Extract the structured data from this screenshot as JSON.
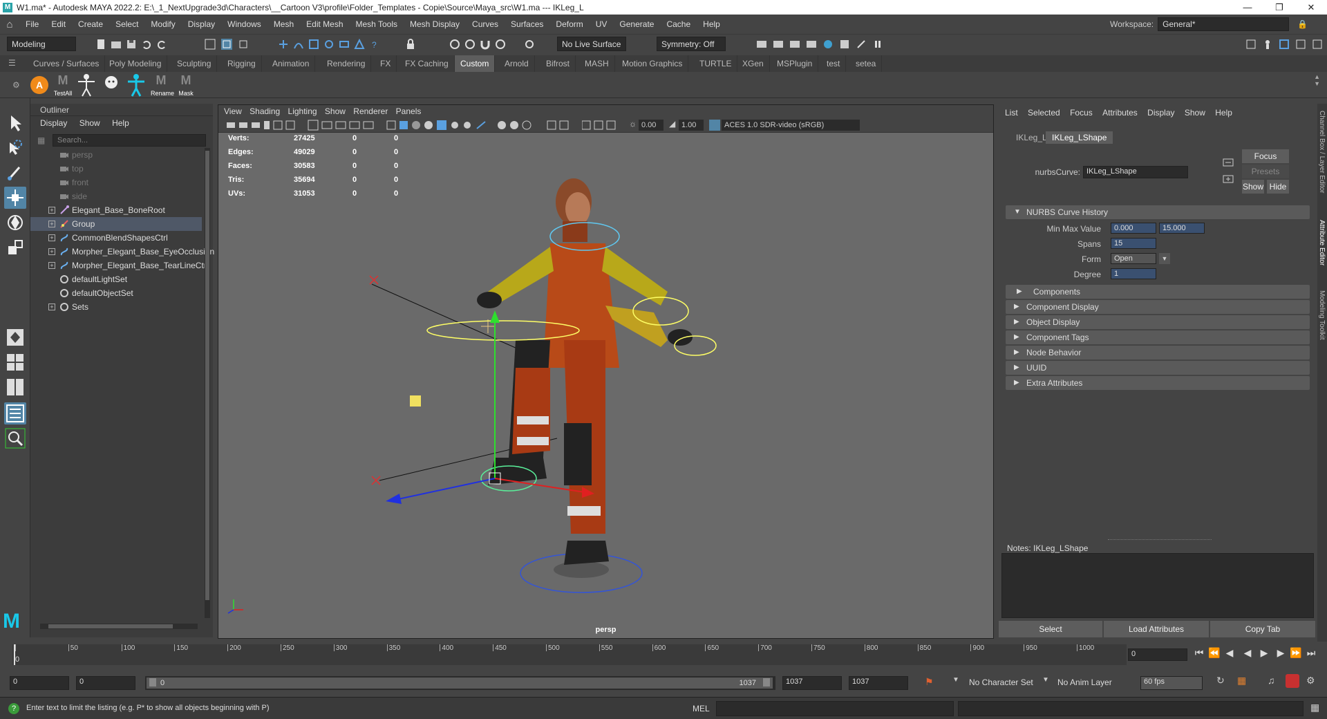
{
  "window": {
    "title": "W1.ma* - Autodesk MAYA 2022.2: E:\\_1_NextUpgrade3d\\Characters\\__Cartoon V3\\profile\\Folder_Templates - Copie\\Source\\Maya_src\\W1.ma  ---  IKLeg_L",
    "logo": "M"
  },
  "menubar": [
    "File",
    "Edit",
    "Create",
    "Select",
    "Modify",
    "Display",
    "Windows",
    "Mesh",
    "Edit Mesh",
    "Mesh Tools",
    "Mesh Display",
    "Curves",
    "Surfaces",
    "Deform",
    "UV",
    "Generate",
    "Cache",
    "Help"
  ],
  "workspace": {
    "label": "Workspace:",
    "value": "General*"
  },
  "statusline": {
    "mode": "Modeling",
    "live_surface": "No Live Surface",
    "symmetry": "Symmetry: Off"
  },
  "shelf_tabs": [
    "Curves / Surfaces",
    "Poly Modeling",
    "Sculpting",
    "Rigging",
    "Animation",
    "Rendering",
    "FX",
    "FX Caching",
    "Custom",
    "Arnold",
    "Bifrost",
    "MASH",
    "Motion Graphics",
    "TURTLE",
    "XGen",
    "MSPlugin",
    "test",
    "setea"
  ],
  "shelf_active": "Custom",
  "shelf_buttons": {
    "testall": "TestAll",
    "rename": "Rename",
    "mask": "Mask",
    "a": "A",
    "m": "M"
  },
  "outliner": {
    "title": "Outliner",
    "menu": [
      "Display",
      "Show",
      "Help"
    ],
    "search_placeholder": "Search...",
    "items": [
      {
        "label": "persp",
        "kind": "camera"
      },
      {
        "label": "top",
        "kind": "camera"
      },
      {
        "label": "front",
        "kind": "camera"
      },
      {
        "label": "side",
        "kind": "camera"
      },
      {
        "label": "Elegant_Base_BoneRoot",
        "kind": "joint"
      },
      {
        "label": "Group",
        "kind": "group",
        "selected": true
      },
      {
        "label": "CommonBlendShapesCtrl",
        "kind": "curve"
      },
      {
        "label": "Morpher_Elegant_Base_EyeOcclusion",
        "kind": "curve"
      },
      {
        "label": "Morpher_Elegant_Base_TearLineCtrl",
        "kind": "curve"
      },
      {
        "label": "defaultLightSet",
        "kind": "set"
      },
      {
        "label": "defaultObjectSet",
        "kind": "set"
      },
      {
        "label": "Sets",
        "kind": "set"
      }
    ]
  },
  "viewport": {
    "menu": [
      "View",
      "Shading",
      "Lighting",
      "Show",
      "Renderer",
      "Panels"
    ],
    "field_a": "0.00",
    "field_b": "1.00",
    "color_space": "ACES 1.0 SDR-video (sRGB)",
    "camera": "persp",
    "hud": [
      {
        "label": "Verts:",
        "v1": "27425",
        "v2": "0",
        "v3": "0"
      },
      {
        "label": "Edges:",
        "v1": "49029",
        "v2": "0",
        "v3": "0"
      },
      {
        "label": "Faces:",
        "v1": "30583",
        "v2": "0",
        "v3": "0"
      },
      {
        "label": "Tris:",
        "v1": "35694",
        "v2": "0",
        "v3": "0"
      },
      {
        "label": "UVs:",
        "v1": "31053",
        "v2": "0",
        "v3": "0"
      }
    ]
  },
  "attribute_editor": {
    "menu": [
      "List",
      "Selected",
      "Focus",
      "Attributes",
      "Display",
      "Show",
      "Help"
    ],
    "tabs": [
      "IKLeg_L",
      "IKLeg_LShape"
    ],
    "active_tab": "IKLeg_LShape",
    "node_type_label": "nurbsCurve:",
    "node_name": "IKLeg_LShape",
    "focus": "Focus",
    "presets": "Presets",
    "show": "Show",
    "hide": "Hide",
    "section_open": "NURBS Curve History",
    "fields": {
      "minmax_label": "Min Max Value",
      "min": "0.000",
      "max": "15.000",
      "spans_label": "Spans",
      "spans": "15",
      "form_label": "Form",
      "form": "Open",
      "degree_label": "Degree",
      "degree": "1"
    },
    "sections": [
      "Components",
      "Component Display",
      "Object Display",
      "Component Tags",
      "Node Behavior",
      "UUID",
      "Extra Attributes"
    ],
    "notes_label": "Notes:  IKLeg_LShape",
    "buttons": [
      "Select",
      "Load Attributes",
      "Copy Tab"
    ]
  },
  "side_tabs": [
    "Channel Box / Layer Editor",
    "Attribute Editor",
    "Modeling Toolkit"
  ],
  "timeslider": {
    "ticks": [
      "0",
      "50",
      "100",
      "150",
      "200",
      "250",
      "300",
      "350",
      "400",
      "450",
      "500",
      "550",
      "600",
      "650",
      "700",
      "750",
      "800",
      "850",
      "900",
      "950",
      "1000"
    ],
    "current_frame": "0",
    "current_marker": "0"
  },
  "rangeslider": {
    "start": "0",
    "anim_start": "0",
    "range_start": "0",
    "range_end": "1037",
    "anim_end": "1037",
    "end": "1037",
    "character_set": "No Character Set",
    "anim_layer": "No Anim Layer",
    "fps": "60 fps"
  },
  "cmdline": {
    "help_text": "Enter text to limit the listing (e.g. P* to show all objects beginning with P)",
    "lang": "MEL"
  },
  "colors": {
    "accent": "#5285a6",
    "selection": "#4f5867",
    "bg": "#444444",
    "viewport": "#6a6a6a"
  }
}
